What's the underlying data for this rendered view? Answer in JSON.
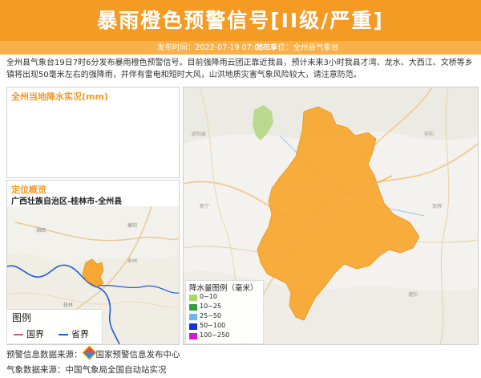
{
  "header": {
    "title": "暴雨橙色预警信号[II级/严重]",
    "publish_time_label": "发布时间：2022-07-19 07:06:15",
    "publish_unit_label": "发布单位：全州县气象台"
  },
  "warning_text": "全州县气象台19日7时6分发布暴雨橙色预警信号。目前强降雨云团正靠近我县，预计未来3小时我县才湾、龙水、大西江、文桥等乡镇将出现50毫米左右的强降雨，并伴有雷电和短时大风，山洪地质灾害气象风险较大，请注意防范。",
  "rainfall_panel": {
    "title": "全州当地降水实况(mm)"
  },
  "location_panel": {
    "title": "定位概览",
    "path": "广西壮族自治区-桂林市-全州县",
    "legend": {
      "title": "图例",
      "national_border": "国界",
      "provincial_border": "省界"
    }
  },
  "rain_legend": {
    "title": "降水量图例（毫米）",
    "items": [
      {
        "label": "0~10",
        "color": "#a6d96a"
      },
      {
        "label": "10~25",
        "color": "#2e9e3e"
      },
      {
        "label": "25~50",
        "color": "#6fb6f0"
      },
      {
        "label": "50~100",
        "color": "#1c2fd6"
      },
      {
        "label": "100~250",
        "color": "#e014d8"
      }
    ]
  },
  "colors": {
    "accent": "#f59a23",
    "warning_area": "#f7a832"
  },
  "footer": {
    "warning_source": "预警信息数据来源：",
    "warning_source_name": "国家预警信息发布中心",
    "weather_source": "气象数据来源：中国气象局全国自动站实况"
  }
}
